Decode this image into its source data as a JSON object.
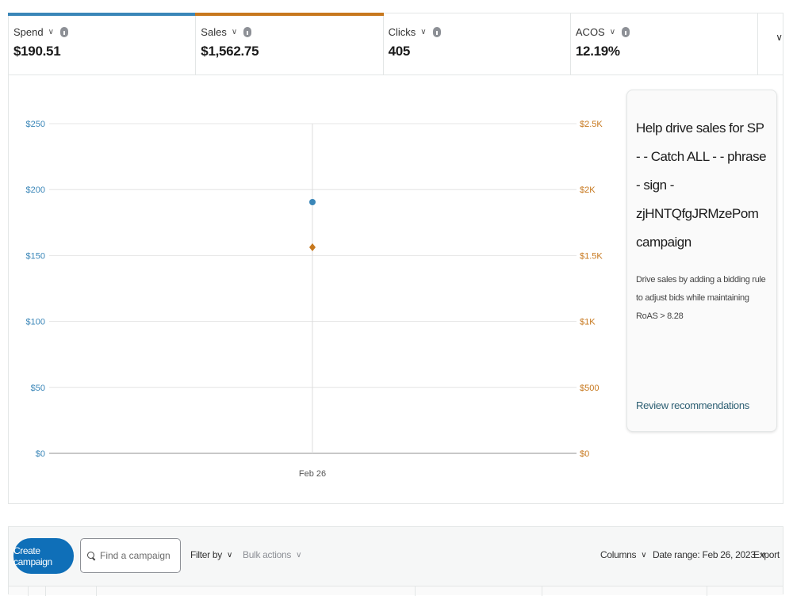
{
  "metrics": [
    {
      "label": "Spend",
      "value": "$190.51",
      "color": "#3a86b8"
    },
    {
      "label": "Sales",
      "value": "$1,562.75",
      "color": "#c7781e"
    },
    {
      "label": "Clicks",
      "value": "405",
      "color": ""
    },
    {
      "label": "ACOS",
      "value": "12.19%",
      "color": ""
    }
  ],
  "metrics_toggle_icon": "chevron-down-icon",
  "chart_data": {
    "type": "scatter",
    "categories": [
      "Feb 26"
    ],
    "series": [
      {
        "name": "Spend",
        "values": [
          190.51
        ],
        "color": "#3a86b8",
        "axis": "left",
        "marker": "circle"
      },
      {
        "name": "Sales",
        "values": [
          1562.75
        ],
        "color": "#c7781e",
        "axis": "right",
        "marker": "diamond"
      }
    ],
    "left_axis": {
      "ticks": [
        "$0",
        "$50",
        "$100",
        "$150",
        "$200",
        "$250"
      ],
      "ylim": [
        0,
        250
      ],
      "color": "#3a86b8"
    },
    "right_axis": {
      "ticks": [
        "$0",
        "$500",
        "$1K",
        "$1.5K",
        "$2K",
        "$2.5K"
      ],
      "ylim": [
        0,
        2500
      ],
      "color": "#c7781e"
    },
    "grid": true
  },
  "recommendation": {
    "title": "Help drive sales for SP - - Catch ALL - - phrase - sign - zjHNTQfgJRMzePom campaign",
    "description": "Drive sales by adding a bidding rule to adjust bids while maintaining RoAS > 8.28",
    "link": "Review recommendations"
  },
  "toolbar": {
    "create_label": "Create campaign",
    "search_placeholder": "Find a campaign",
    "filter_label": "Filter by",
    "bulk_label": "Bulk actions",
    "columns_label": "Columns",
    "date_range_label": "Date range: Feb 26, 2023",
    "export_label": "Export"
  }
}
